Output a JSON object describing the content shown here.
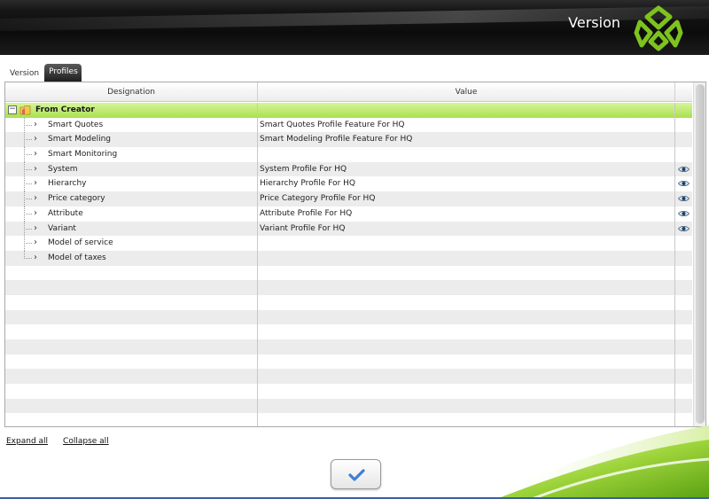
{
  "header": {
    "title": "Version"
  },
  "tabs": [
    {
      "label": "Version",
      "active": false
    },
    {
      "label": "Profiles",
      "active": true
    }
  ],
  "grid": {
    "columns": {
      "designation": "Designation",
      "value": "Value"
    },
    "group": {
      "label": "From Creator",
      "expander": "−"
    },
    "rows": [
      {
        "designation": "Smart Quotes",
        "value": "Smart Quotes Profile Feature For HQ",
        "view_icon": false
      },
      {
        "designation": "Smart Modeling",
        "value": "Smart Modeling Profile Feature For HQ",
        "view_icon": false
      },
      {
        "designation": "Smart Monitoring",
        "value": "",
        "view_icon": false
      },
      {
        "designation": "System",
        "value": "System Profile For HQ",
        "view_icon": true
      },
      {
        "designation": "Hierarchy",
        "value": "Hierarchy Profile For HQ",
        "view_icon": true
      },
      {
        "designation": "Price category",
        "value": "Price Category Profile For HQ",
        "view_icon": true
      },
      {
        "designation": "Attribute",
        "value": "Attribute Profile For HQ",
        "view_icon": true
      },
      {
        "designation": "Variant",
        "value": "Variant Profile For HQ",
        "view_icon": true
      },
      {
        "designation": "Model of service",
        "value": "",
        "view_icon": false
      },
      {
        "designation": "Model of taxes",
        "value": "",
        "view_icon": false
      }
    ],
    "chevron": "›",
    "empty_rows": 11
  },
  "footer": {
    "expand_all": "Expand all",
    "collapse_all": "Collapse all"
  },
  "colors": {
    "group_row": "#a9e04f",
    "stripe": "#ececec",
    "accent_green": "#7ec21f",
    "confirm_check": "#3f7fd6"
  },
  "icons": {
    "logo": "brand-logo-icon",
    "folder": "folder-icon",
    "view": "eye-icon",
    "confirm": "checkmark-icon"
  }
}
